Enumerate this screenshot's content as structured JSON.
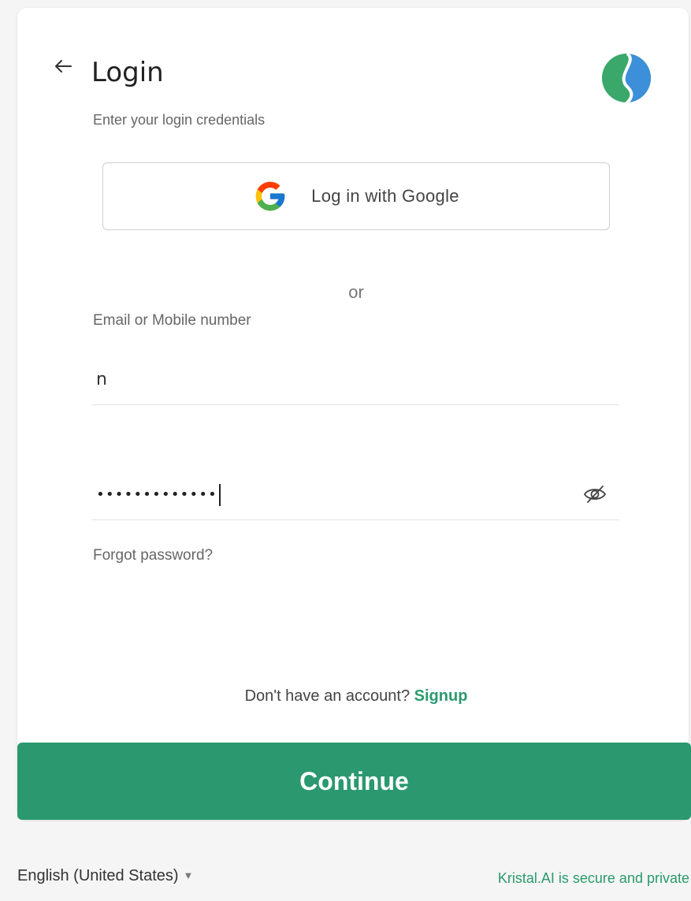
{
  "header": {
    "title": "Login",
    "subtitle": "Enter your login credentials"
  },
  "google_button": {
    "label": "Log in with Google"
  },
  "divider": {
    "text": "or"
  },
  "email": {
    "label": "Email or Mobile number",
    "value": "n"
  },
  "password": {
    "masked_value": "•••••••••••••"
  },
  "links": {
    "forgot_password": "Forgot password?",
    "no_account_text": "Don't have an account?",
    "signup": "Signup"
  },
  "continue_button": {
    "label": "Continue"
  },
  "footer": {
    "language": "English (United States)",
    "secure_text": "Kristal.AI is secure and private"
  },
  "icons": {
    "back": "back-arrow-icon",
    "logo": "kristal-logo",
    "google": "google-icon",
    "eye": "eye-slash-icon",
    "dropdown": "caret-down-icon"
  },
  "colors": {
    "accent": "#2b9870",
    "link": "#2a9a6e",
    "logo_green": "#3aa86a",
    "logo_blue": "#3c8fd8"
  }
}
